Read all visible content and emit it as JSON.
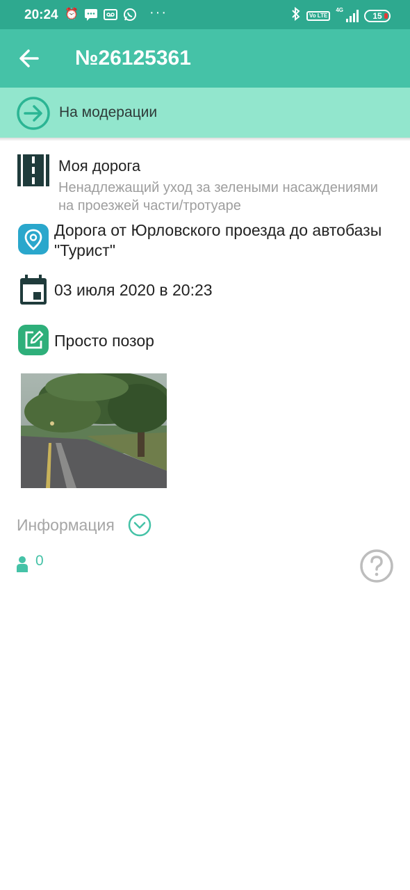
{
  "status_bar": {
    "time": "20:24",
    "battery": "15",
    "network": "4G",
    "volte": "Vo LTE",
    "left_icons": [
      "alarm-icon",
      "message-icon",
      "voicemail-icon",
      "whatsapp-icon"
    ],
    "overflow": "···"
  },
  "header": {
    "title": "№26125361",
    "background_color": "#45c2a7"
  },
  "status": {
    "label": "На модерации",
    "background_color": "#92e6cd"
  },
  "details": {
    "category_title": "Моя дорога",
    "category_subtitle": "Ненадлежащий уход за зелеными насаждениями на проезжей части/тротуаре",
    "address": "Дорога от Юрловского проезда до автобазы \"Турист\"",
    "date": "03 июля 2020 в 20:23",
    "comment": "Просто позор"
  },
  "photo": {
    "icon": "photo-thumbnail"
  },
  "info": {
    "label": "Информация",
    "user_count": "0"
  },
  "colors": {
    "accent": "#45c2a7",
    "status_bar": "#2ea98f",
    "location_icon": "#2aa7cc",
    "comment_icon": "#2eaf7a",
    "dark_icon": "#1f3b3b"
  }
}
